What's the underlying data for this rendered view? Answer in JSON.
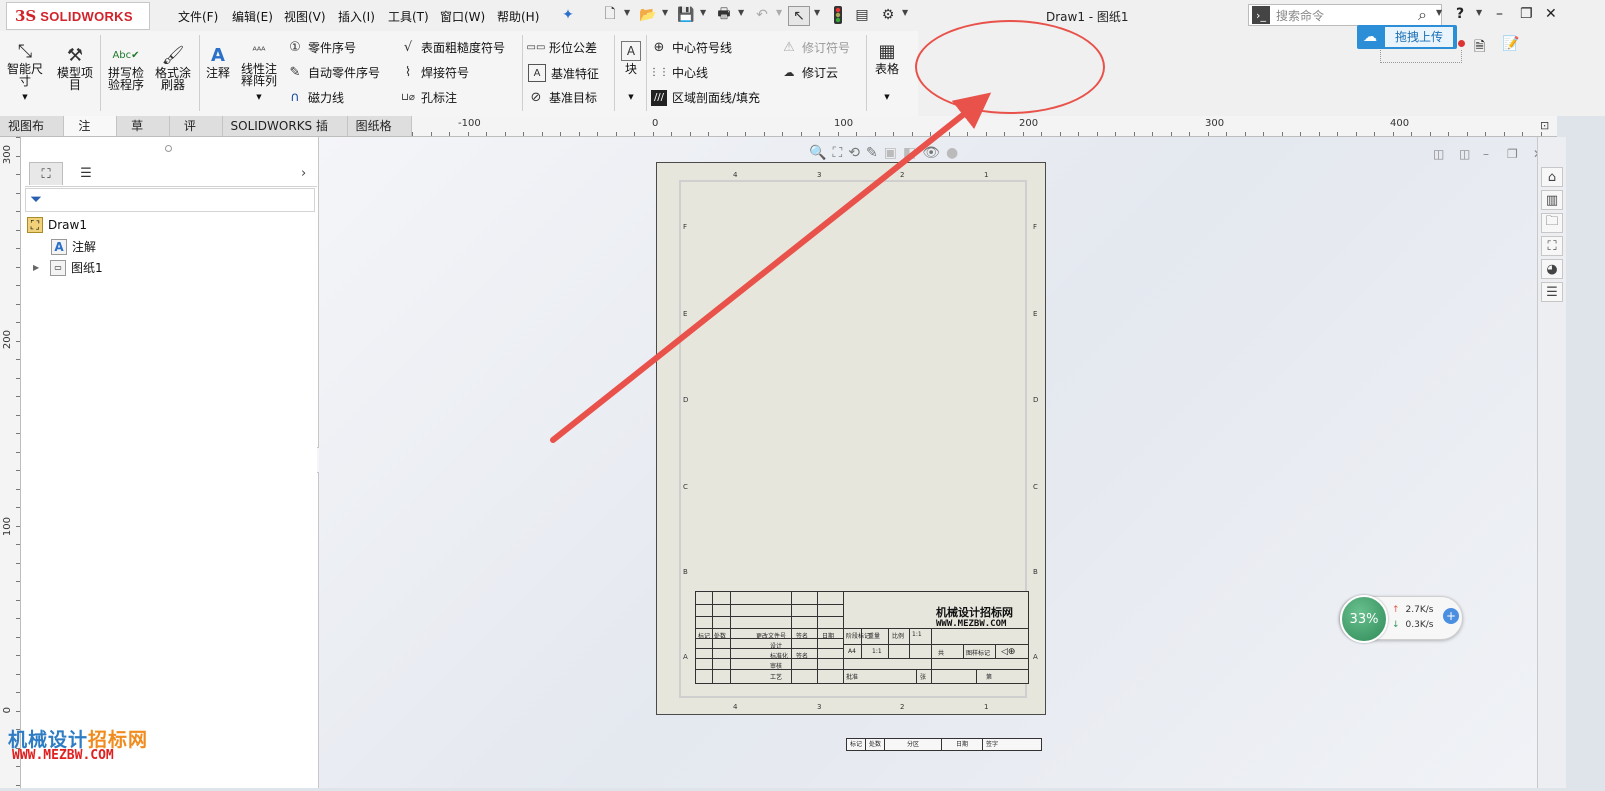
{
  "app": {
    "brand": "SOLIDWORKS",
    "doc_title": "Draw1 - 图纸1"
  },
  "menu": [
    "文件(F)",
    "编辑(E)",
    "视图(V)",
    "插入(I)",
    "工具(T)",
    "窗口(W)",
    "帮助(H)"
  ],
  "search": {
    "placeholder": "搜索命令"
  },
  "baidu": {
    "label": "拖拽上传"
  },
  "ribbon": {
    "smart_dim": "智能尺\n寸",
    "model_items": "模型项\n目",
    "spell_check": "拼写检\n验程序",
    "format_painter": "格式涂\n刷器",
    "note": "注释",
    "linear_pattern": "线性注\n释阵列",
    "balloon": "零件序号",
    "auto_balloon": "自动零件序号",
    "magnetic_line": "磁力线",
    "surface_finish": "表面粗糙度符号",
    "weld_symbol": "焊接符号",
    "hole_callout": "孔标注",
    "geometric_tol": "形位公差",
    "datum_feature": "基准特征",
    "datum_target": "基准目标",
    "block": "块",
    "center_mark": "中心符号线",
    "centerline": "中心线",
    "hatch": "区域剖面线/填充",
    "revision_symbol": "修订符号",
    "revision_cloud": "修订云",
    "table": "表格"
  },
  "tabs": [
    "视图布局",
    "注解",
    "草图",
    "评估",
    "SOLIDWORKS 插件",
    "图纸格式"
  ],
  "active_tab": "注解",
  "hruler": [
    "-100",
    "0",
    "100",
    "200",
    "300",
    "400"
  ],
  "vruler": [
    "300",
    "200",
    "100",
    "0"
  ],
  "tree": {
    "root": "Draw1",
    "annotations": "注解",
    "sheet": "图纸1"
  },
  "sheet": {
    "col_zones": [
      "4",
      "3",
      "2",
      "1"
    ],
    "row_zones": [
      "F",
      "E",
      "D",
      "C",
      "B",
      "A"
    ],
    "company": "机械设计招标网",
    "url": "WWW.MEZBW.COM",
    "labels": [
      "标记",
      "处数",
      "分区",
      "更改文件号",
      "签名",
      "日期",
      "设计",
      "标准化",
      "阶段标记",
      "重量",
      "比例",
      "审核",
      "工艺",
      "批准",
      "共",
      "张",
      "第",
      "张",
      "图样标记",
      "A4",
      "1:1"
    ]
  },
  "rev_table": [
    "标记",
    "处数",
    "分区",
    "日期",
    "签字"
  ],
  "speed": {
    "percent": "33%",
    "up": "2.7K/s",
    "down": "0.3K/s"
  },
  "watermark": {
    "line1_a": "机械设计",
    "line1_b": "招标网",
    "line2": "WWW.MEZBW.COM"
  },
  "colors": {
    "annotation_red": "#e8524a",
    "brand_red": "#d2232a",
    "baidu_blue": "#2d8ed8",
    "speed_green": "#3a9a66"
  }
}
